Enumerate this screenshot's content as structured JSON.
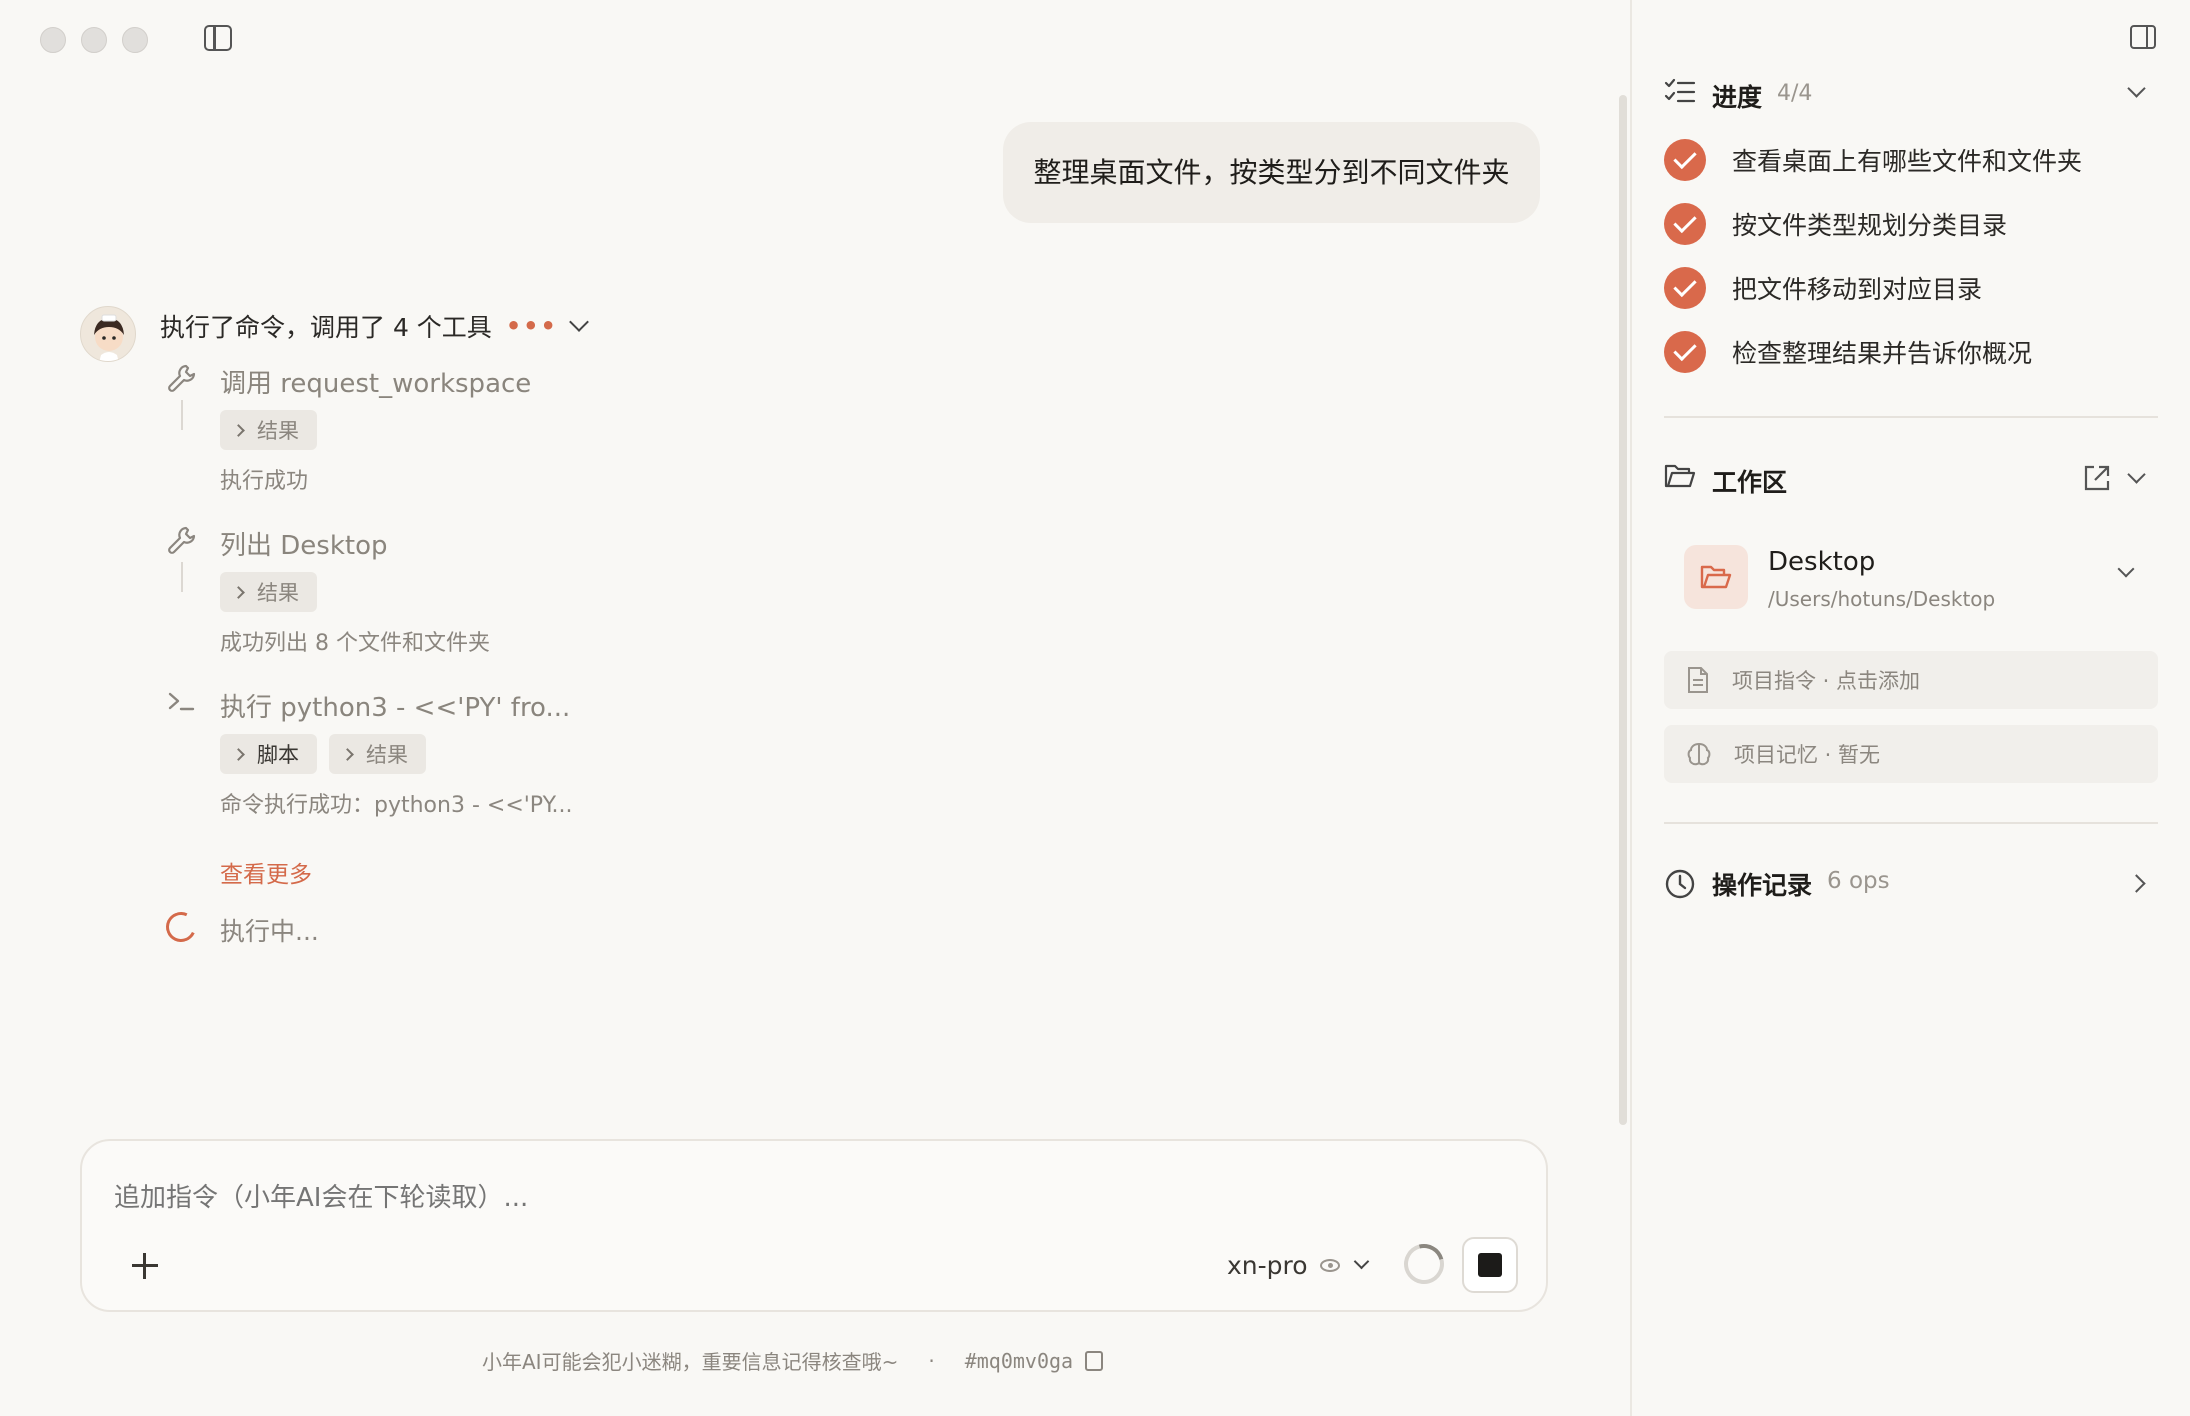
{
  "user_message": "整理桌面文件，按类型分到不同文件夹",
  "assistant": {
    "summary": "执行了命令，调用了 4 个工具",
    "steps": [
      {
        "icon": "wrench-icon",
        "title": "调用 request_workspace",
        "chips": [
          "结果"
        ],
        "result": "执行成功"
      },
      {
        "icon": "wrench-icon",
        "title": "列出 Desktop",
        "chips": [
          "结果"
        ],
        "result": "成功列出 8 个文件和文件夹"
      },
      {
        "icon": "terminal-icon",
        "title": "执行 python3 - <<'PY' fro...",
        "chips": [
          "脚本",
          "结果"
        ],
        "result": "命令执行成功：python3 - <<'PY..."
      }
    ],
    "see_more": "查看更多",
    "running": "执行中..."
  },
  "composer": {
    "placeholder": "追加指令（小年AI会在下轮读取）...",
    "model": "xn-pro"
  },
  "footer": {
    "disclaimer": "小年AI可能会犯小迷糊，重要信息记得核查哦~",
    "separator": "·",
    "session_id": "#mq0mv0ga"
  },
  "progress": {
    "title": "进度",
    "count": "4/4",
    "tasks": [
      "查看桌面上有哪些文件和文件夹",
      "按文件类型规划分类目录",
      "把文件移动到对应目录",
      "检查整理结果并告诉你概况"
    ]
  },
  "workspace": {
    "title": "工作区",
    "folder_name": "Desktop",
    "folder_path": "/Users/hotuns/Desktop",
    "instructions": "项目指令 · 点击添加",
    "memory": "项目记忆 · 暂无"
  },
  "ops": {
    "title": "操作记录",
    "count": "6 ops"
  },
  "colors": {
    "accent": "#d9694b",
    "background": "#f9f8f5"
  }
}
